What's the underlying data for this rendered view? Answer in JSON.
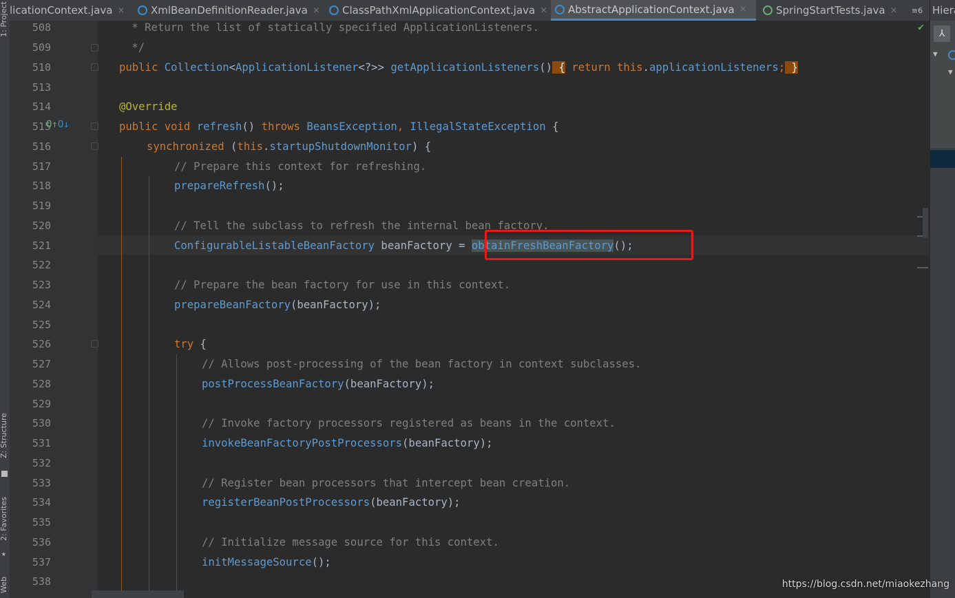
{
  "tabs": [
    {
      "label": "licationContext.java",
      "icon": "class-icon",
      "active": false
    },
    {
      "label": "XmlBeanDefinitionReader.java",
      "icon": "class-icon",
      "active": false
    },
    {
      "label": "ClassPathXmlApplicationContext.java",
      "icon": "class-icon",
      "active": false
    },
    {
      "label": "AbstractApplicationContext.java",
      "icon": "abstract-class-icon",
      "active": true
    },
    {
      "label": "SpringStartTests.java",
      "icon": "spring-class-icon",
      "active": false
    }
  ],
  "tab_close_glyph": "×",
  "tab_overflow": "≡6",
  "tool_windows": {
    "project": "1: Project",
    "structure": "Z: Structure",
    "favorites": "2: Favorites",
    "web": "Web"
  },
  "hierarchy_title": "Hiera",
  "line_numbers": [
    "508",
    "509",
    "510",
    "513",
    "514",
    "515",
    "516",
    "517",
    "518",
    "519",
    "520",
    "521",
    "522",
    "523",
    "524",
    "525",
    "526",
    "527",
    "528",
    "529",
    "530",
    "531",
    "532",
    "533",
    "534",
    "535",
    "536",
    "537",
    "538"
  ],
  "code": {
    "l508": " * Return the list of statically specified ApplicationListeners.",
    "l509": " */",
    "l510_kw": "public",
    "l510_type": "Collection",
    "l510_generic_open": "<",
    "l510_generic_type": "ApplicationListener",
    "l510_generic_rest": "<?>>",
    "l510_method": "getApplicationListeners",
    "l510_parens": "()",
    "l510_brace_open": " {",
    "l510_return": "return",
    "l510_this": "this",
    "l510_dot": ".",
    "l510_field": "applicationListeners",
    "l510_semi": ";",
    "l510_brace_close": " }",
    "l514": "@Override",
    "l515_public": "public",
    "l515_void": "void",
    "l515_method": "refresh",
    "l515_parens": "()",
    "l515_throws": "throws",
    "l515_ex1": "BeansException",
    "l515_comma": ",",
    "l515_ex2": "IllegalStateException",
    "l515_brace": " {",
    "l516_sync": "synchronized",
    "l516_open": " (",
    "l516_this": "this",
    "l516_dot": ".",
    "l516_field": "startupShutdownMonitor",
    "l516_close": ") {",
    "l517": "// Prepare this context for refreshing.",
    "l518_m": "prepareRefresh",
    "l518_r": "();",
    "l520": "// Tell the subclass to refresh the internal bean factory.",
    "l521_type": "ConfigurableListableBeanFactory",
    "l521_var": " beanFactory = ",
    "l521_m": "obtainFreshBeanFactory",
    "l521_r": "();",
    "l523": "// Prepare the bean factory for use in this context.",
    "l524_m": "prepareBeanFactory",
    "l524_r": "(beanFactory);",
    "l526_try": "try",
    "l526_brace": " {",
    "l527": "// Allows post-processing of the bean factory in context subclasses.",
    "l528_m": "postProcessBeanFactory",
    "l528_r": "(beanFactory);",
    "l530": "// Invoke factory processors registered as beans in the context.",
    "l531_m": "invokeBeanFactoryPostProcessors",
    "l531_r": "(beanFactory);",
    "l533": "// Register bean processors that intercept bean creation.",
    "l534_m": "registerBeanPostProcessors",
    "l534_r": "(beanFactory);",
    "l536": "// Initialize message source for this context.",
    "l537_m": "initMessageSource",
    "l537_r": "();"
  },
  "gutter_markers": {
    "override": "O↑",
    "implemented": "O↓"
  },
  "inspection_ok": "✔",
  "watermark": "https://blog.csdn.net/miaokezhang",
  "colors": {
    "keyword": "#cc7832",
    "method": "#5f9bd1",
    "comment": "#808080",
    "annotation": "#bbb529",
    "highlight_box": "#e01d1d",
    "active_tab_underline": "#4a88c7"
  }
}
